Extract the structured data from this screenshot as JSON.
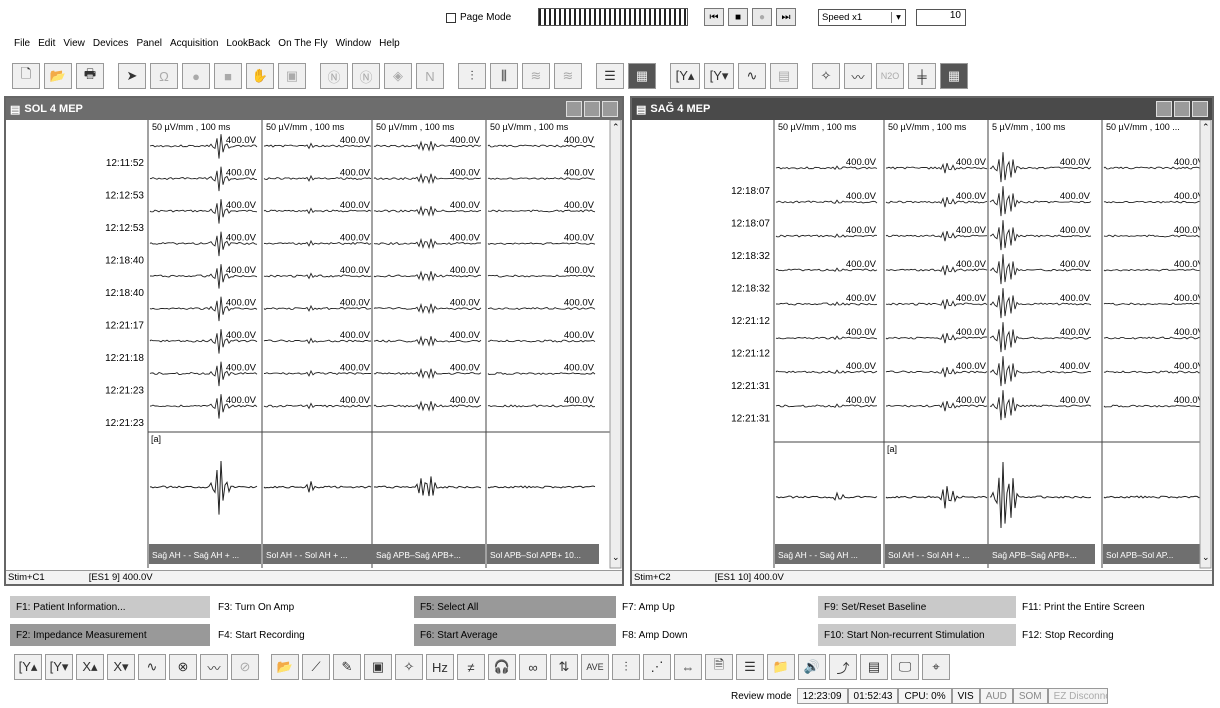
{
  "topbar": {
    "page_mode": "Page Mode",
    "speed": "Speed x1",
    "speed_value": "10"
  },
  "menu": [
    "File",
    "Edit",
    "View",
    "Devices",
    "Panel",
    "Acquisition",
    "LookBack",
    "On The Fly",
    "Window",
    "Help"
  ],
  "left_window": {
    "title": "SOL 4  MEP",
    "channel_headers": [
      "50 µV/mm , 100 ms",
      "50 µV/mm , 100 ms",
      "50 µV/mm , 100 ms",
      "50 µV/mm , 100 ms"
    ],
    "times": [
      "12:11:52",
      "12:12:53",
      "12:12:53",
      "12:18:40",
      "12:18:40",
      "12:21:17",
      "12:21:18",
      "12:21:23",
      "12:21:23"
    ],
    "value_label": "400.0V",
    "marker": "[a]",
    "footers": [
      "Sağ AH - - Sağ AH + ...",
      "Sol AH - - Sol AH + ...",
      "Sağ APB–Sağ APB+...",
      "Sol APB–Sol APB+ 10..."
    ],
    "status_left": "Stim+C1",
    "status_right": "[ES1 9] 400.0V"
  },
  "right_window": {
    "title": "SAĞ 4  MEP",
    "channel_headers": [
      "50 µV/mm , 100 ms",
      "50 µV/mm , 100 ms",
      "5 µV/mm , 100 ms",
      "50 µV/mm , 100 ..."
    ],
    "times": [
      "12:18:07",
      "12:18:07",
      "12:18:32",
      "12:18:32",
      "12:21:12",
      "12:21:12",
      "12:21:31",
      "12:21:31"
    ],
    "value_label": "400.0V",
    "marker": "[a]",
    "footers": [
      "Sağ AH - - Sağ AH ...",
      "Sol AH - - Sol AH + ...",
      "Sağ APB–Sağ APB+...",
      "Sol APB–Sol AP..."
    ],
    "status_left": "Stim+C2",
    "status_right": "[ES1 10] 400.0V"
  },
  "function_keys": [
    {
      "label": "F1: Patient Information...",
      "style": "grey"
    },
    {
      "label": "F3: Turn On Amp",
      "style": "none"
    },
    {
      "label": "F5: Select All",
      "style": "dark"
    },
    {
      "label": "F7: Amp Up",
      "style": "none"
    },
    {
      "label": "F9: Set/Reset Baseline",
      "style": "grey"
    },
    {
      "label": "F11: Print the Entire Screen",
      "style": "none"
    },
    {
      "label": "F2: Impedance Measurement",
      "style": "dark"
    },
    {
      "label": "F4: Start Recording",
      "style": "none"
    },
    {
      "label": "F6: Start Average",
      "style": "dark"
    },
    {
      "label": "F8: Amp Down",
      "style": "none"
    },
    {
      "label": "F10: Start Non-recurrent Stimulation",
      "style": "grey"
    },
    {
      "label": "F12: Stop Recording",
      "style": "none"
    }
  ],
  "statusbar": {
    "mode": "Review mode",
    "time1": "12:23:09",
    "time2": "01:52:43",
    "cpu": "CPU: 0%",
    "vis": "VIS",
    "aud": "AUD",
    "som": "SOM",
    "ez": "EZ Disconnect"
  },
  "icons": {
    "toolbar1": [
      "new-file",
      "open-folder",
      "print",
      "stimulus-arrow",
      "ohm",
      "record-dot",
      "stop-square",
      "hand",
      "page",
      "n-circle",
      "n-circle-2",
      "n-diamond",
      "n-square",
      "traces-a",
      "traces-b",
      "traces-c",
      "traces-d",
      "traces-e",
      "raster",
      "y-up",
      "y-down",
      "waveform",
      "grid-small",
      "neuron",
      "waveform-b",
      "n2o",
      "hz-bars",
      "black-grid"
    ],
    "toolbar2": [
      "y-up",
      "y-down",
      "x-up",
      "x-down",
      "wave-a",
      "wave-b",
      "wave-c",
      "no-sign",
      "open",
      "slope",
      "edit",
      "box",
      "neuron",
      "hz",
      "filter",
      "headphones",
      "glasses",
      "arrows",
      "ave-n",
      "bars",
      "dots",
      "arrow-lr",
      "doc",
      "list",
      "folder",
      "speaker",
      "curve",
      "stack",
      "screens",
      "binoculars"
    ]
  }
}
